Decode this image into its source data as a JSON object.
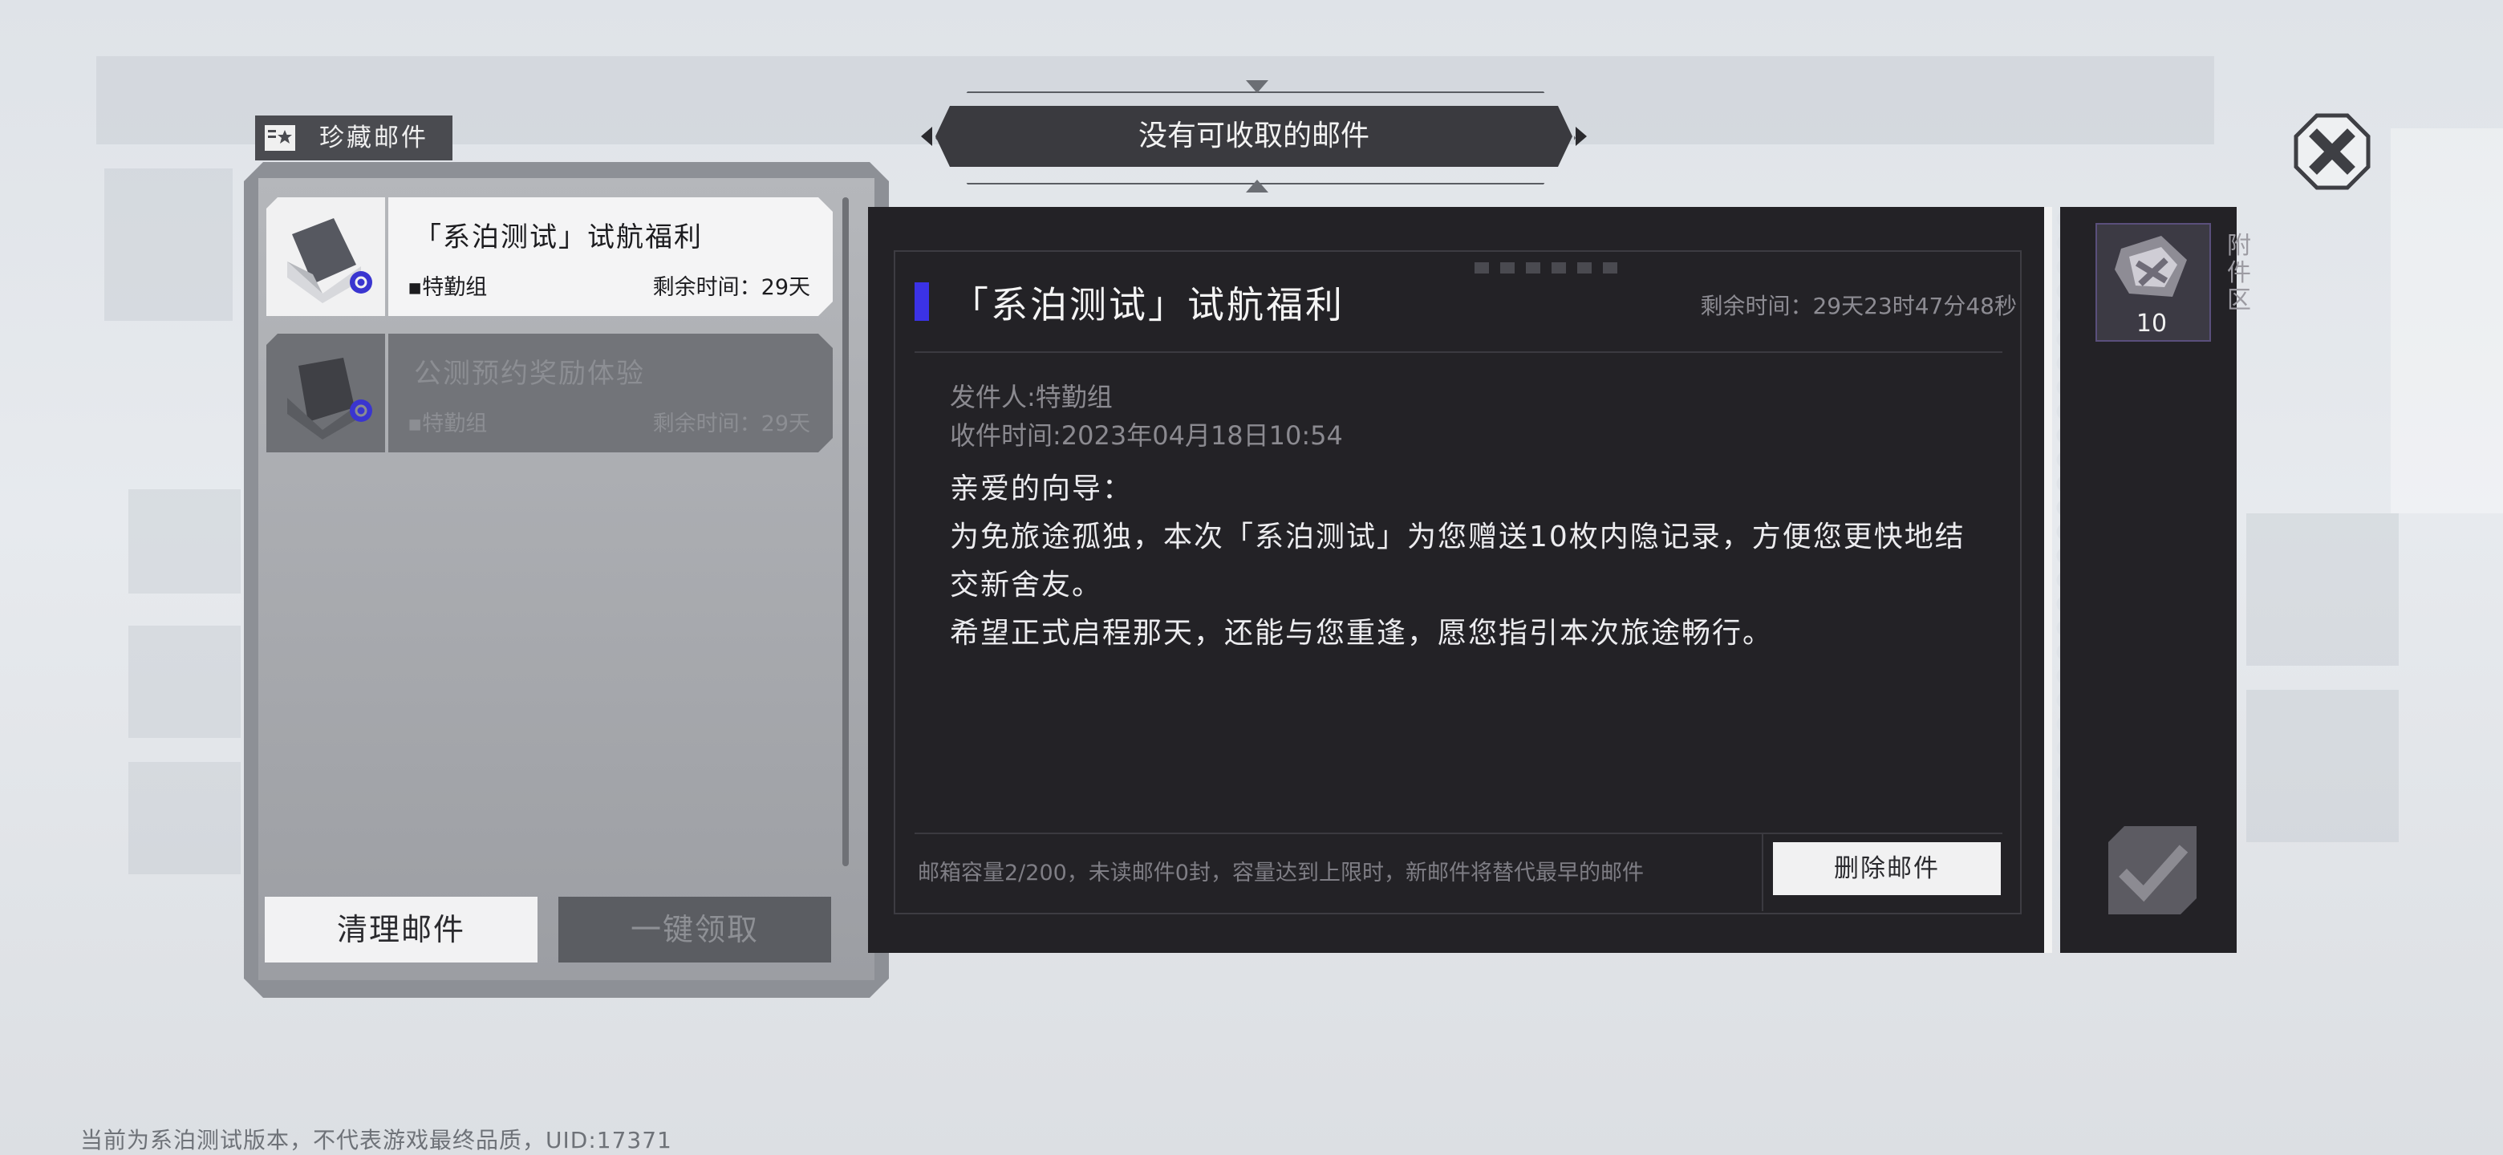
{
  "notice": {
    "text": "没有可收取的邮件"
  },
  "favorites_tab": {
    "label": "珍藏邮件"
  },
  "mail_list": [
    {
      "title": "「系泊测试」试航福利",
      "sender": "▪特勤组",
      "remaining": "剩余时间：29天",
      "state": "selected"
    },
    {
      "title": "公测预约奖励体验",
      "sender": "▪特勤组",
      "remaining": "剩余时间：29天",
      "state": "read"
    }
  ],
  "buttons": {
    "clear": "清理邮件",
    "claim_all": "一键领取",
    "delete": "删除邮件"
  },
  "mail_detail": {
    "title": "「系泊测试」试航福利",
    "remaining_full": "剩余时间：29天23时47分48秒",
    "sender": "发件人:特勤组",
    "received": "收件时间:2023年04月18日10:54",
    "paragraphs": [
      "亲爱的向导：",
      "为免旅途孤独，本次「系泊测试」为您赠送10枚内隐记录，方便您更快地结交新舍友。",
      "希望正式启程那天，还能与您重逢，愿您指引本次旅途畅行。"
    ]
  },
  "capacity_text": "邮箱容量2/200，未读邮件0封，容量达到上限时，新邮件将替代最早的邮件",
  "attachments": {
    "label": "附件区",
    "items": [
      {
        "icon": "memory-record-icon",
        "count": "10"
      }
    ]
  },
  "footer": {
    "version_text": "当前为系泊测试版本，不代表游戏最终品质，UID:17371"
  },
  "colors": {
    "accent": "#3b32e6",
    "panel_dark": "#232226",
    "panel_gray": "#8d9096"
  }
}
